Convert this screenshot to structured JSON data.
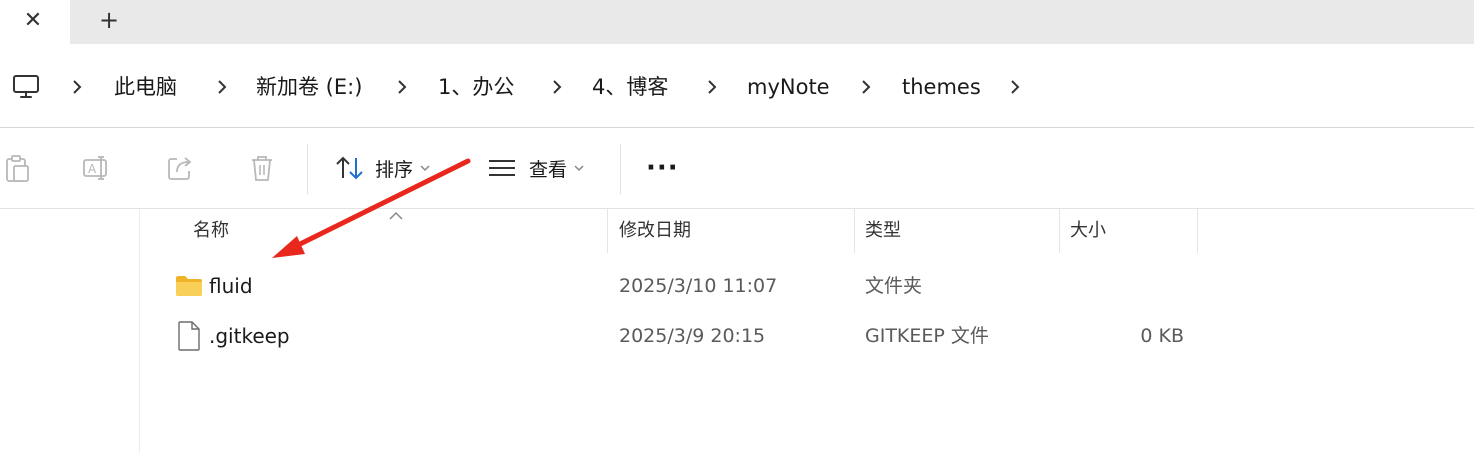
{
  "tabs": {
    "close_glyph": "✕",
    "new_glyph": "+"
  },
  "address": {
    "root_icon": "computer-icon",
    "crumbs": [
      "此电脑",
      "新加卷 (E:)",
      "1、办公",
      "4、博客",
      "myNote",
      "themes"
    ],
    "separator_icon": "chevron-right-icon"
  },
  "toolbar": {
    "icons": [
      "paste-icon",
      "rename-icon",
      "share-icon",
      "delete-icon"
    ],
    "sort_label": "排序",
    "view_label": "查看",
    "more_label": "···"
  },
  "columns": {
    "name": "名称",
    "modified": "修改日期",
    "type": "类型",
    "size": "大小"
  },
  "files": [
    {
      "icon": "folder-icon",
      "name": "fluid",
      "modified": "2025/3/10 11:07",
      "type": "文件夹",
      "size": ""
    },
    {
      "icon": "file-icon",
      "name": ".gitkeep",
      "modified": "2025/3/9 20:15",
      "type": "GITKEEP 文件",
      "size": "0 KB"
    }
  ],
  "colors": {
    "annotation_arrow": "#e8281d",
    "folder": "#f5c242",
    "tabstrip": "#e9e9e9"
  }
}
